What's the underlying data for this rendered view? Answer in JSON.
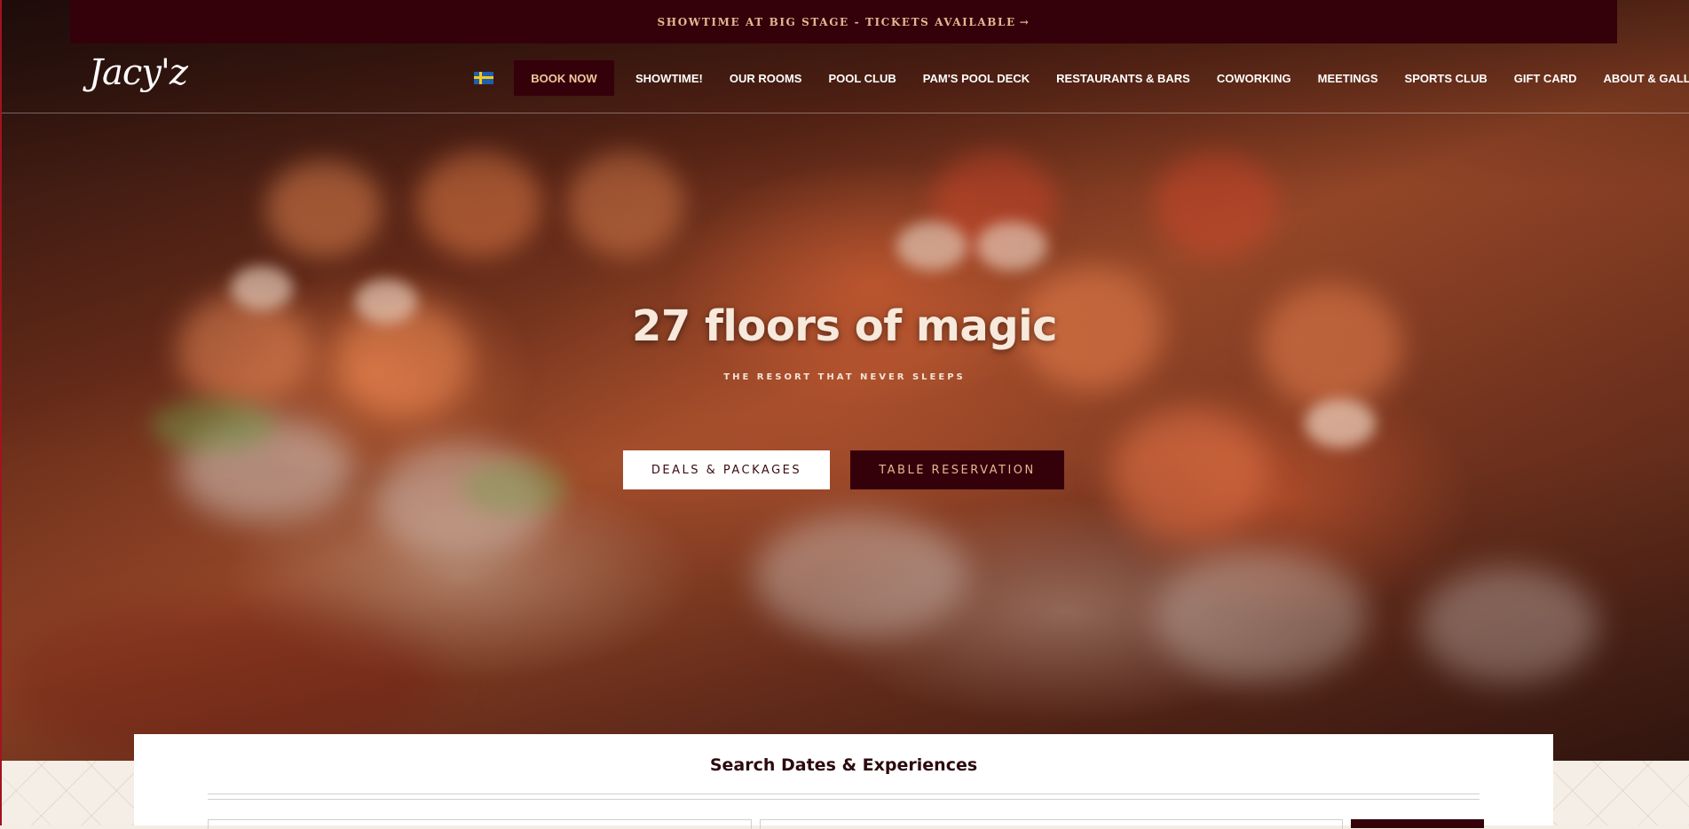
{
  "announcement": {
    "text": "SHOWTIME AT BIG STAGE - TICKETS AVAILABLE",
    "arrow_icon": "arrow-right-icon"
  },
  "header": {
    "logo_text": "Jacy'z",
    "language_flag": "swedish-flag-icon",
    "book_now": "BOOK NOW",
    "nav_items": [
      "SHOWTIME!",
      "OUR ROOMS",
      "POOL CLUB",
      "PAM'S POOL DECK",
      "RESTAURANTS & BARS",
      "COWORKING",
      "MEETINGS",
      "SPORTS CLUB",
      "GIFT CARD",
      "ABOUT & GALLERY"
    ]
  },
  "hero": {
    "title": "27 floors of magic",
    "subtitle": "THE RESORT THAT NEVER SLEEPS",
    "cta_primary": "DEALS & PACKAGES",
    "cta_secondary": "TABLE RESERVATION"
  },
  "search": {
    "title": "Search Dates & Experiences"
  },
  "colors": {
    "brand_dark": "#34000a",
    "accent_gold": "#e2b892",
    "book_text": "#f0c99b",
    "frame_red": "#a31220",
    "page_bg": "#f4ede4"
  }
}
